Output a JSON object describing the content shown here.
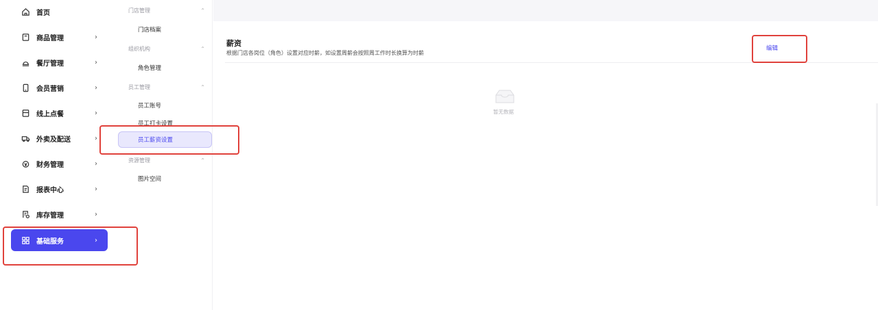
{
  "nav": {
    "items": [
      {
        "label": "首页",
        "icon": "home-icon",
        "has_chevron": false
      },
      {
        "label": "商品管理",
        "icon": "shopping-bag-icon",
        "has_chevron": true
      },
      {
        "label": "餐厅管理",
        "icon": "restaurant-icon",
        "has_chevron": true
      },
      {
        "label": "会员营销",
        "icon": "phone-icon",
        "has_chevron": true
      },
      {
        "label": "线上点餐",
        "icon": "order-icon",
        "has_chevron": true
      },
      {
        "label": "外卖及配送",
        "icon": "truck-icon",
        "has_chevron": true
      },
      {
        "label": "财务管理",
        "icon": "money-icon",
        "has_chevron": true
      },
      {
        "label": "报表中心",
        "icon": "report-icon",
        "has_chevron": true
      },
      {
        "label": "库存管理",
        "icon": "inventory-icon",
        "has_chevron": true
      },
      {
        "label": "基础服务",
        "icon": "grid-icon",
        "has_chevron": true,
        "active": true
      }
    ],
    "chevron": "›",
    "accent": "#4a47ee"
  },
  "subnav": {
    "groups": [
      {
        "title": "门店管理",
        "items": [
          "门店档案"
        ]
      },
      {
        "title": "组织机构",
        "items": [
          "角色管理"
        ]
      },
      {
        "title": "员工管理",
        "items": [
          "员工账号",
          "员工打卡设置",
          "员工薪资设置"
        ]
      },
      {
        "title": "资源管理",
        "items": [
          "图片空间"
        ]
      }
    ],
    "active_item": "员工薪资设置",
    "collapse_glyph": "⌃"
  },
  "main": {
    "title": "薪资",
    "description": "根据门店各岗位（角色）设置对应时薪，如设置周薪会按照周工作时长换算为时薪",
    "edit_label": "编辑",
    "empty_text": "暂无数据"
  },
  "annotation_color": "#e0413b"
}
